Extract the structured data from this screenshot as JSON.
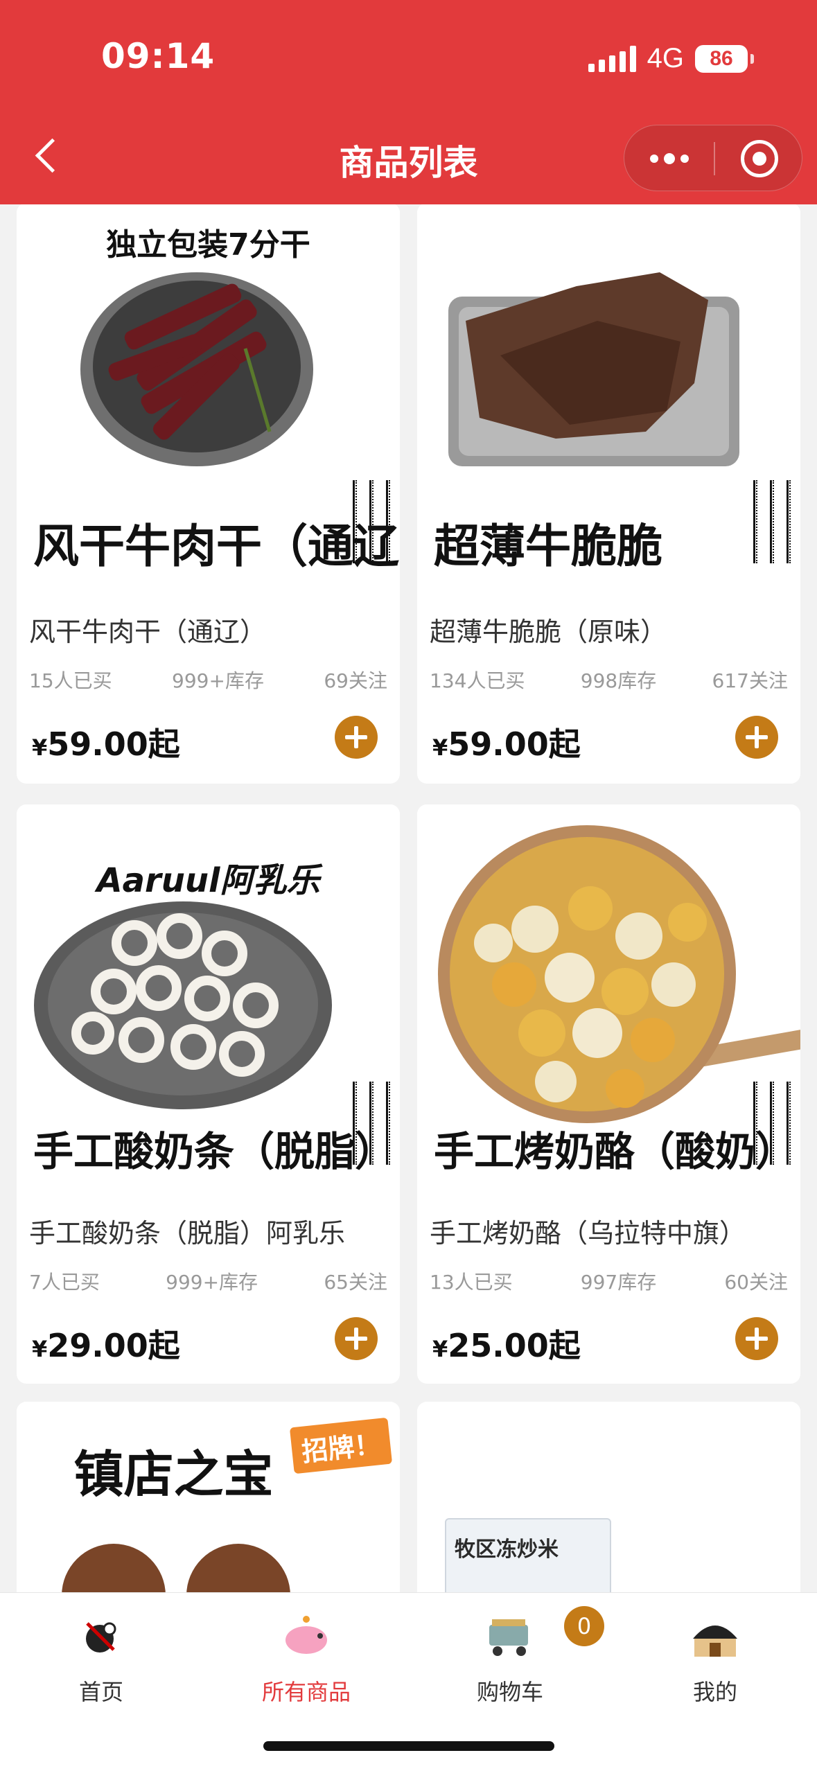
{
  "status_bar": {
    "time": "09:14",
    "network": "4G",
    "battery": "86"
  },
  "header": {
    "title": "商品列表"
  },
  "products": [
    {
      "image_caption": "独立包装7分干",
      "image_title": "风干牛肉干（通辽",
      "name": "风干牛肉干（通辽）",
      "bought": "15人已买",
      "stock": "999+库存",
      "follow": "69关注",
      "currency": "¥",
      "price": "59.00起"
    },
    {
      "image_caption": "",
      "image_title": "超薄牛脆脆",
      "name": "超薄牛脆脆（原味）",
      "bought": "134人已买",
      "stock": "998库存",
      "follow": "617关注",
      "currency": "¥",
      "price": "59.00起"
    },
    {
      "image_caption": "Aaruul阿乳乐",
      "image_title": "手工酸奶条（脱脂）",
      "name": "手工酸奶条（脱脂）阿乳乐",
      "bought": "7人已买",
      "stock": "999+库存",
      "follow": "65关注",
      "currency": "¥",
      "price": "29.00起"
    },
    {
      "image_caption": "",
      "image_title": "手工烤奶酪（酸奶）",
      "name": "手工烤奶酪（乌拉特中旗）",
      "bought": "13人已买",
      "stock": "997库存",
      "follow": "60关注",
      "currency": "¥",
      "price": "25.00起"
    },
    {
      "image_caption": "镇店之宝",
      "image_badge": "招牌！"
    },
    {
      "image_caption": "牧区冻炒米"
    }
  ],
  "tabbar": {
    "items": [
      {
        "label": "首页"
      },
      {
        "label": "所有商品"
      },
      {
        "label": "购物车"
      },
      {
        "label": "我的"
      }
    ],
    "active": "所有商品",
    "cart_count": "0"
  },
  "colors": {
    "header": "#e23a3c",
    "accent": "#c47b17",
    "active_tab": "#e23a3c"
  }
}
